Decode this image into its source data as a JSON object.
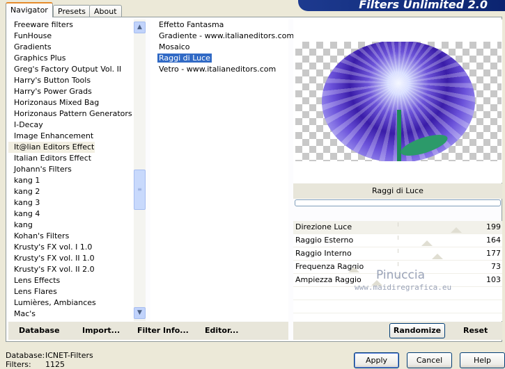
{
  "banner_title": "Filters Unlimited 2.0",
  "tabs": [
    {
      "label": "Navigator",
      "active": true
    },
    {
      "label": "Presets",
      "active": false
    },
    {
      "label": "About",
      "active": false
    }
  ],
  "categories": [
    "Freeware filters",
    "FunHouse",
    "Gradients",
    "Graphics Plus",
    "Greg's Factory Output Vol. II",
    "Harry's Button Tools",
    "Harry's Power Grads",
    "Horizonaus Mixed Bag",
    "Horizonaus Pattern Generators",
    "I-Decay",
    "Image Enhancement",
    "It@lian Editors Effect",
    "Italian Editors Effect",
    "Johann's Filters",
    "kang 1",
    "kang 2",
    "kang 3",
    "kang 4",
    "kang",
    "Kohan's Filters",
    "Krusty's FX vol. I 1.0",
    "Krusty's FX vol. II 1.0",
    "Krusty's FX vol. II 2.0",
    "Lens Effects",
    "Lens Flares",
    "Lumières, Ambiances",
    "Mac's"
  ],
  "selected_category": "It@lian Editors Effect",
  "filters": [
    "Effetto Fantasma",
    "Gradiente - www.italianeditors.com",
    "Mosaico",
    "Raggi di Luce",
    "Vetro - www.italianeditors.com"
  ],
  "selected_filter": "Raggi di Luce",
  "effect_name": "Raggi di Luce",
  "parameters": [
    {
      "label": "Direzione Luce",
      "value": "199",
      "level": 0.78
    },
    {
      "label": "Raggio Esterno",
      "value": "164",
      "level": 0.64
    },
    {
      "label": "Raggio Interno",
      "value": "177",
      "level": 0.69
    },
    {
      "label": "Frequenza Raggio",
      "value": "73",
      "level": 0.29
    },
    {
      "label": "Ampiezza Raggio",
      "value": "103",
      "level": 0.4
    }
  ],
  "watermark": {
    "name": "Pinuccia",
    "url": "www.maidiregrafica.eu"
  },
  "toolbar": {
    "database": "Database",
    "import": "Import...",
    "filter_info": "Filter Info...",
    "editor": "Editor...",
    "randomize": "Randomize",
    "reset": "Reset"
  },
  "status": {
    "database_label": "Database:",
    "database_value": "ICNET-Filters",
    "filters_label": "Filters:",
    "filters_value": "1125"
  },
  "dialog_buttons": {
    "apply": "Apply",
    "cancel": "Cancel",
    "help": "Help"
  },
  "colors": {
    "selection": "#316ac5",
    "banner": "#1d3a8f",
    "accent_tab": "#e68b2c"
  }
}
